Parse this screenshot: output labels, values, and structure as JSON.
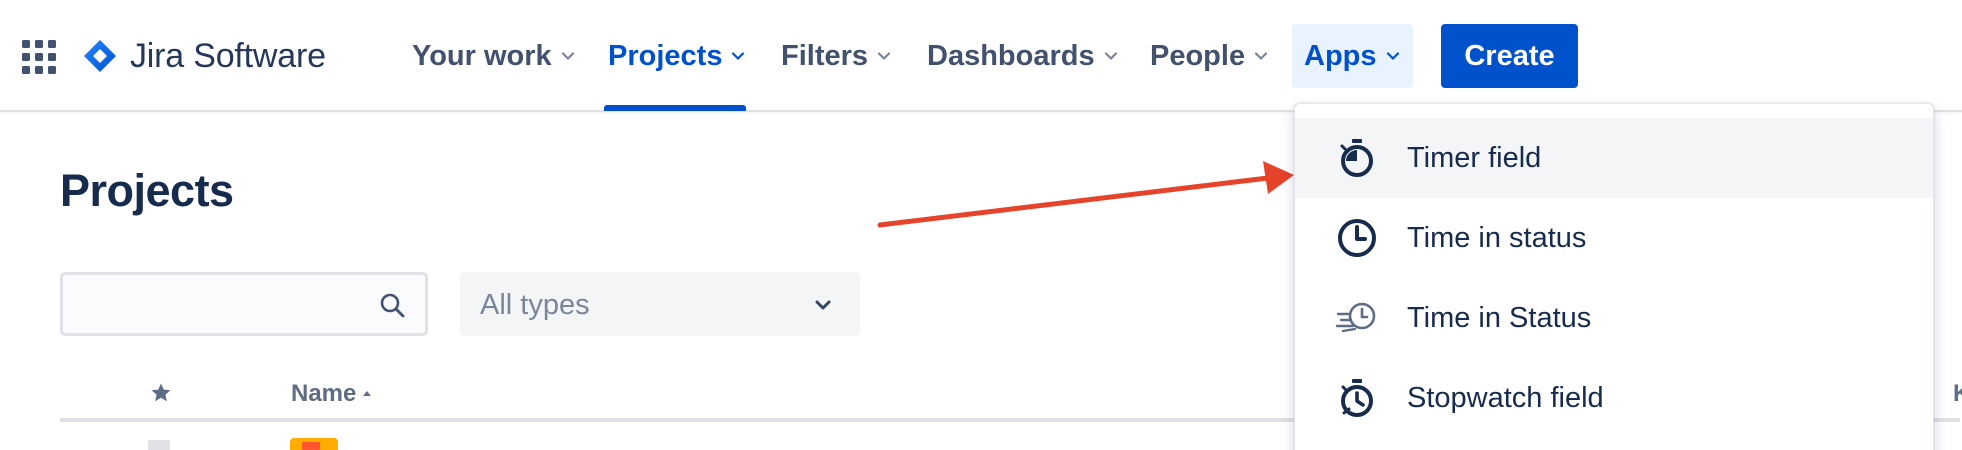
{
  "nav": {
    "logo_text": "Jira Software",
    "items": [
      {
        "label": "Your work"
      },
      {
        "label": "Projects"
      },
      {
        "label": "Filters"
      },
      {
        "label": "Dashboards"
      },
      {
        "label": "People"
      },
      {
        "label": "Apps"
      }
    ],
    "active_item": "Projects",
    "create_label": "Create"
  },
  "page": {
    "title": "Projects",
    "search": {
      "value": "",
      "placeholder": ""
    },
    "type_filter": {
      "selected": "All types"
    },
    "table": {
      "columns": [
        "",
        "Name",
        "K"
      ]
    }
  },
  "apps_menu": {
    "items": [
      {
        "label": "Timer field",
        "icon": "timer-icon",
        "hovered": true
      },
      {
        "label": "Time in status",
        "icon": "clock-icon",
        "hovered": false
      },
      {
        "label": "Time in Status",
        "icon": "fast-clock-icon",
        "hovered": false
      },
      {
        "label": "Stopwatch field",
        "icon": "stopwatch-icon",
        "hovered": false
      }
    ]
  },
  "colors": {
    "primary": "#0052cc",
    "text": "#172b4d",
    "nav_text": "#42526e",
    "annotation_arrow": "#e5432a"
  }
}
